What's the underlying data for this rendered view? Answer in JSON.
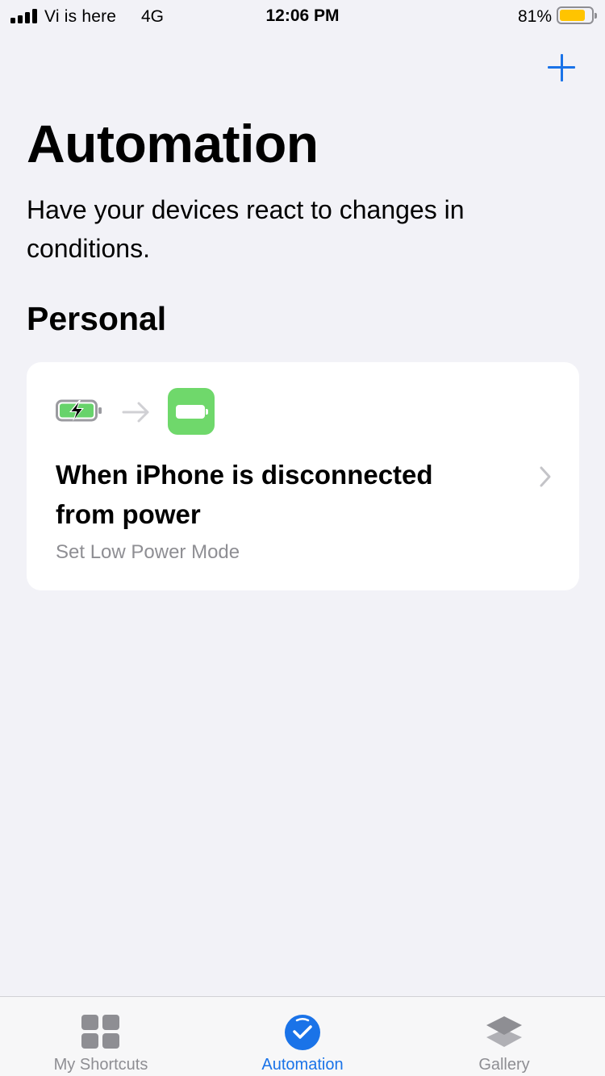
{
  "status_bar": {
    "carrier": "Vi is here",
    "network": "4G",
    "time": "12:06 PM",
    "battery_percent": "81%",
    "battery_level": 0.81,
    "battery_color": "#ffc400"
  },
  "header": {
    "add_icon": "plus-icon",
    "title": "Automation",
    "subtitle": "Have your devices react to changes in conditions."
  },
  "section": {
    "title": "Personal"
  },
  "automations": [
    {
      "icons": [
        "battery-charging-icon",
        "arrow-right-icon",
        "battery-icon"
      ],
      "title": "When iPhone is disconnected from power",
      "subtitle": "Set Low Power Mode"
    }
  ],
  "tab_bar": {
    "tabs": [
      {
        "label": "My Shortcuts",
        "icon": "grid-icon",
        "active": false
      },
      {
        "label": "Automation",
        "icon": "automation-check-icon",
        "active": true
      },
      {
        "label": "Gallery",
        "icon": "gallery-layers-icon",
        "active": false
      }
    ],
    "accent_color": "#1a73e8"
  }
}
